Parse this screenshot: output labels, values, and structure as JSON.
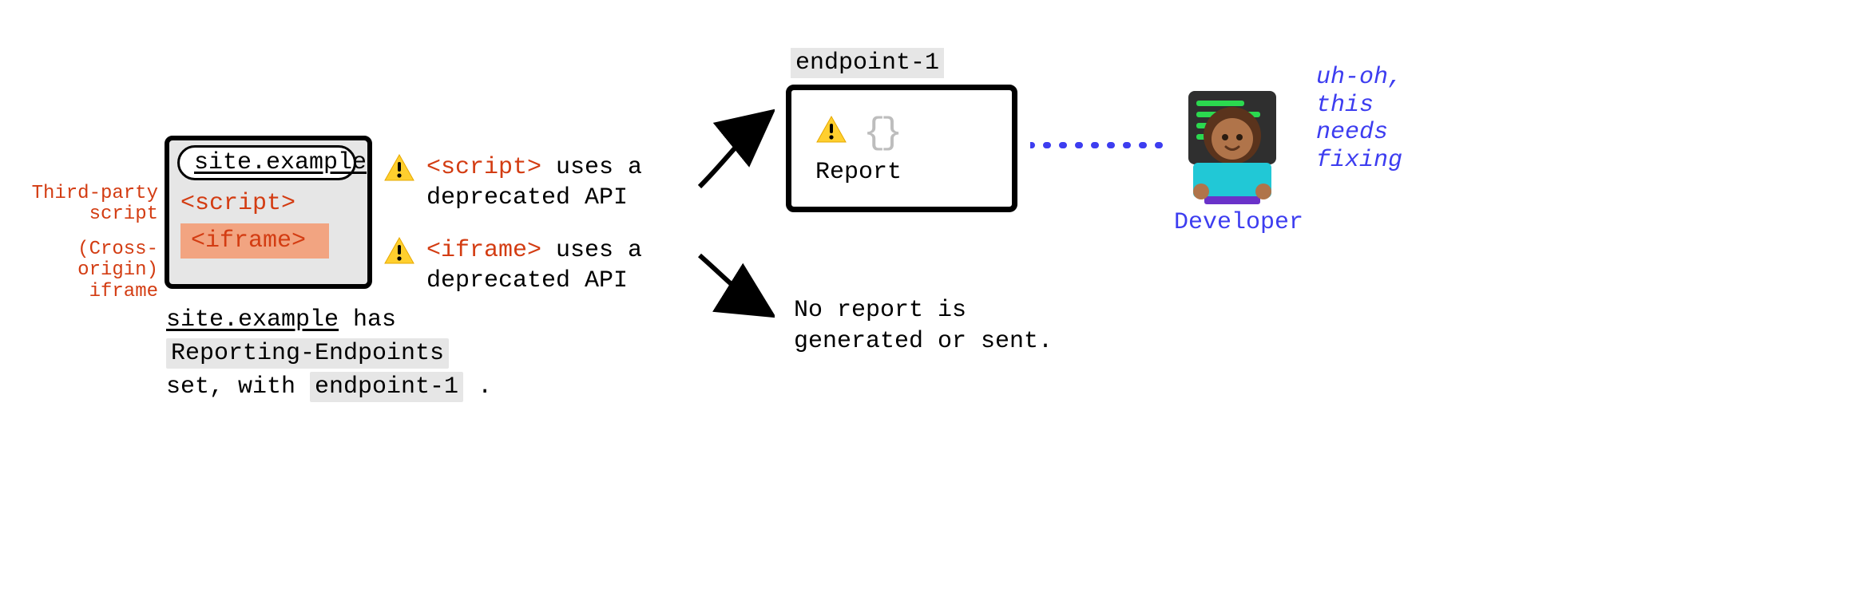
{
  "left_annotations": {
    "script": "Third-party\nscript",
    "iframe": "(Cross-origin)\niframe"
  },
  "window": {
    "url": "site.example",
    "script_tag": "<script>",
    "iframe_tag": "<iframe>"
  },
  "caption": {
    "line1_prefix": "",
    "site": "site.example",
    "line1_suffix": " has",
    "line2_code": "Reporting-Endpoints",
    "line3_prefix": "set, with ",
    "line3_code": "endpoint-1",
    "line3_suffix": " ."
  },
  "messages": {
    "script": {
      "tag": "<script>",
      "text": " uses a deprecated API"
    },
    "iframe": {
      "tag": "<iframe>",
      "text": " uses a deprecated API"
    }
  },
  "endpoint": {
    "label": "endpoint-1",
    "report": "Report"
  },
  "no_report": "No report is\ngenerated or sent.",
  "developer": {
    "label": "Developer",
    "quote": "uh-oh,\nthis\nneeds\nfixing"
  }
}
